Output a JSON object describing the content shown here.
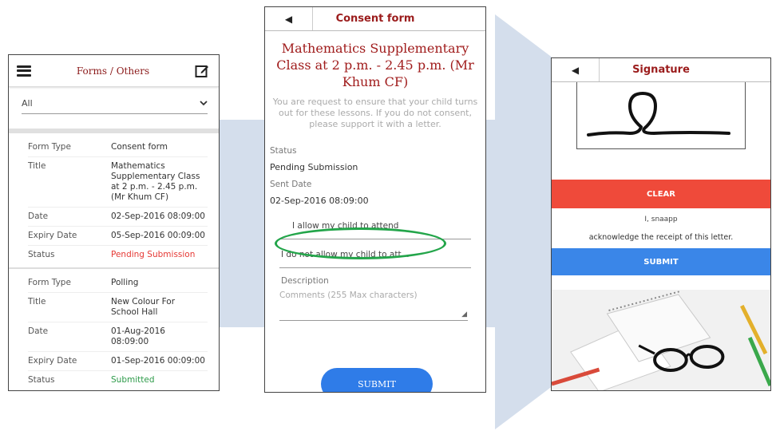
{
  "forms_list": {
    "header_title": "Forms / Others",
    "filter_value": "All",
    "records": [
      {
        "rows": [
          {
            "label": "Form Type",
            "value": "Consent form"
          },
          {
            "label": "Title",
            "value": "Mathematics Supplementary Class at 2 p.m. - 2.45 p.m. (Mr Khum CF)"
          },
          {
            "label": "Date",
            "value": "02-Sep-2016 08:09:00"
          },
          {
            "label": "Expiry Date",
            "value": "05-Sep-2016 00:09:00"
          },
          {
            "label": "Status",
            "value": "Pending Submission"
          }
        ]
      },
      {
        "rows": [
          {
            "label": "Form Type",
            "value": "Polling"
          },
          {
            "label": "Title",
            "value": "New Colour For School Hall"
          },
          {
            "label": "Date",
            "value": "01-Aug-2016 08:09:00"
          },
          {
            "label": "Expiry Date",
            "value": "01-Sep-2016 00:09:00"
          },
          {
            "label": "Status",
            "value": "Submitted"
          }
        ]
      }
    ]
  },
  "consent_form": {
    "header_title": "Consent form",
    "title": "Mathematics Supplementary Class at 2 p.m. - 2.45 p.m. (Mr Khum CF)",
    "description": "You are request to ensure that your child turns out for these lessons. If you do not consent, please support it with a letter.",
    "status_label": "Status",
    "status_value": "Pending Submission",
    "sent_date_label": "Sent Date",
    "sent_date_value": "02-Sep-2016 08:09:00",
    "option_allow": "I allow my child to attend",
    "option_disallow": "I do not allow my child to att...",
    "description_label": "Description",
    "comments_placeholder": "Comments (255 Max characters)",
    "submit_label": "SUBMIT"
  },
  "signature": {
    "header_title": "Signature",
    "clear_label": "CLEAR",
    "signer_name": "I, snaapp",
    "acknowledge_text": "acknowledge the receipt of this letter.",
    "submit_label": "SUBMIT"
  },
  "colors": {
    "header_red": "#9b1c1c",
    "pending_red": "#e53935",
    "submitted_green": "#2e9b4a",
    "submit_blue": "#2f7ce8",
    "clear_red": "#ef4a3a",
    "highlight_green": "#23a54a"
  },
  "icons": {
    "menu": "hamburger-menu-icon",
    "edit": "edit-pencil-icon",
    "dropdown": "chevron-down-icon",
    "back": "back-triangle-icon",
    "resize": "resize-grip-icon"
  }
}
